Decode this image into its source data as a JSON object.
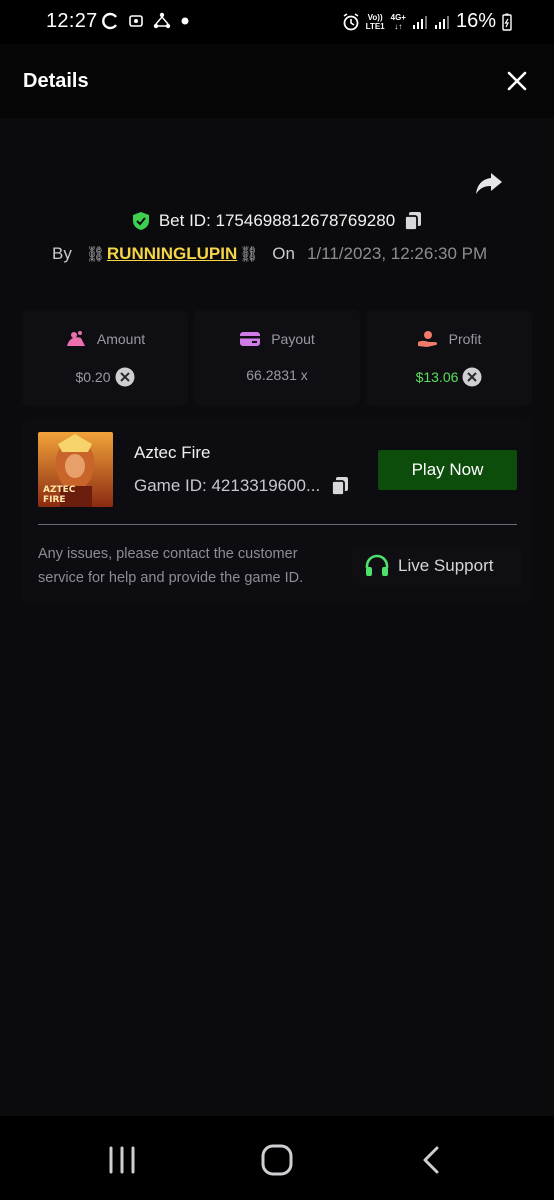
{
  "status_bar": {
    "time": "12:27",
    "battery": "16%",
    "network_top": "Vo))",
    "network_bottom": "LTE1",
    "network_4g": "4G+"
  },
  "header": {
    "title": "Details"
  },
  "bet": {
    "bet_id": "Bet ID: 1754698812678769280",
    "by_label": "By",
    "chain_left": "⛓",
    "username": "RUNNINGLUPIN",
    "chain_right": "⛓",
    "on_label": "On",
    "date": "1/11/2023, 12:26:30 PM"
  },
  "stats": {
    "amount_label": "Amount",
    "amount_value": "$0.20",
    "payout_label": "Payout",
    "payout_value": "66.2831 x",
    "profit_label": "Profit",
    "profit_value": "$13.06"
  },
  "game": {
    "name": "Aztec Fire",
    "game_id": "Game ID: 4213319600...",
    "thumb_title_line1": "AZTEC",
    "thumb_title_line2": "FIRE",
    "play_label": "Play Now",
    "help_text": "Any issues, please contact the customer service for help and provide the game ID.",
    "support_label": "Live Support"
  },
  "colors": {
    "accent_green": "#58e05a",
    "play_button_bg": "#0c4d0c",
    "username_color": "#f5d547",
    "background": "#0b0b0e"
  },
  "icons": [
    "shield-check-icon",
    "copy-icon",
    "share-icon",
    "close-icon",
    "coin-icon",
    "card-icon",
    "hand-coin-icon",
    "cancel-circle-icon",
    "headset-icon",
    "recent-apps-icon",
    "home-icon",
    "back-icon"
  ]
}
